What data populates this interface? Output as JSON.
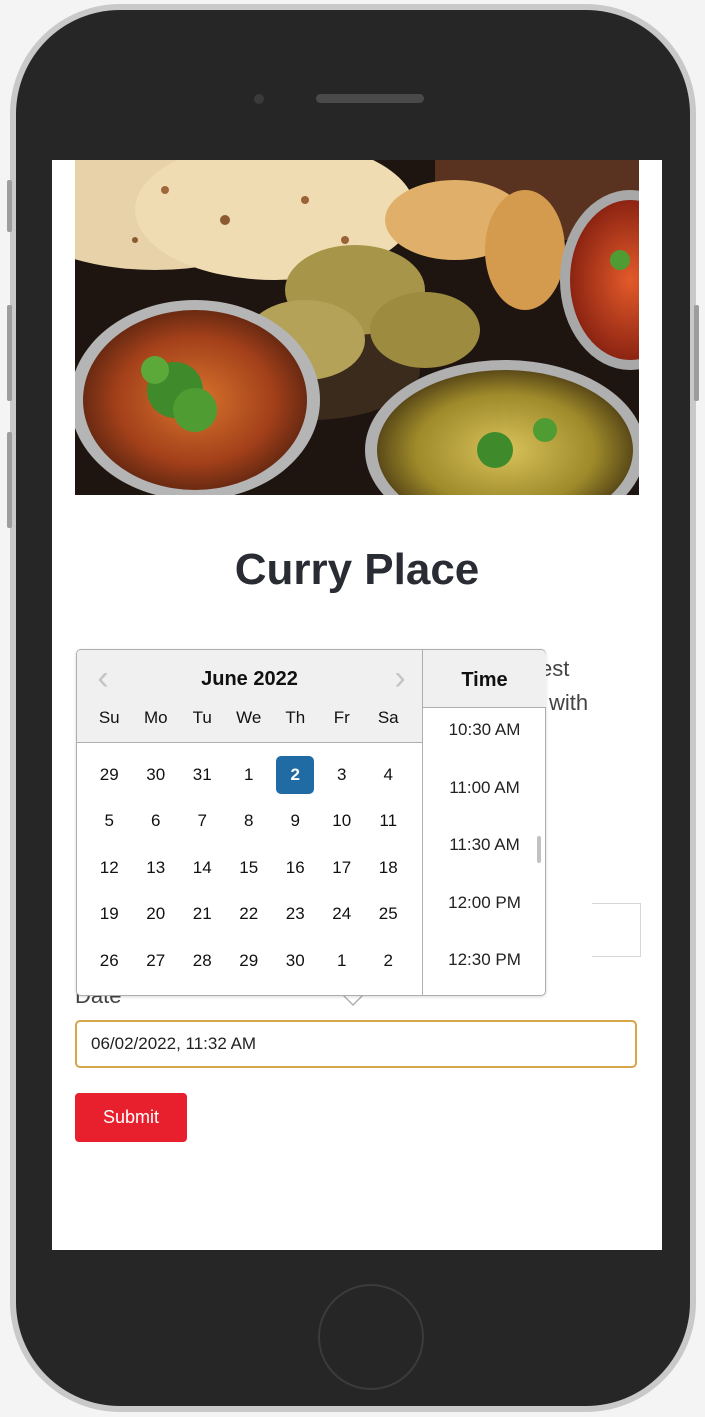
{
  "app": {
    "title": "Curry Place"
  },
  "hero": {
    "alt": "Indian curry dishes"
  },
  "partial_text": {
    "line1": "est",
    "line2": "l with"
  },
  "datepicker": {
    "month_label": "June 2022",
    "prev_icon": "chevron-left-icon",
    "next_icon": "chevron-right-icon",
    "weekdays": [
      "Su",
      "Mo",
      "Tu",
      "We",
      "Th",
      "Fr",
      "Sa"
    ],
    "weeks": [
      [
        "29",
        "30",
        "31",
        "1",
        "2",
        "3",
        "4"
      ],
      [
        "5",
        "6",
        "7",
        "8",
        "9",
        "10",
        "11"
      ],
      [
        "12",
        "13",
        "14",
        "15",
        "16",
        "17",
        "18"
      ],
      [
        "19",
        "20",
        "21",
        "22",
        "23",
        "24",
        "25"
      ],
      [
        "26",
        "27",
        "28",
        "29",
        "30",
        "1",
        "2"
      ]
    ],
    "selected_day": "2",
    "time_header": "Time",
    "times": [
      "10:30 AM",
      "11:00 AM",
      "11:30 AM",
      "12:00 PM",
      "12:30 PM"
    ]
  },
  "form": {
    "date_label": "Date",
    "date_value": "06/02/2022, 11:32 AM",
    "submit_label": "Submit"
  },
  "colors": {
    "accent": "#216ba5",
    "submit": "#e8202e",
    "focus_border": "#d8a64a"
  }
}
